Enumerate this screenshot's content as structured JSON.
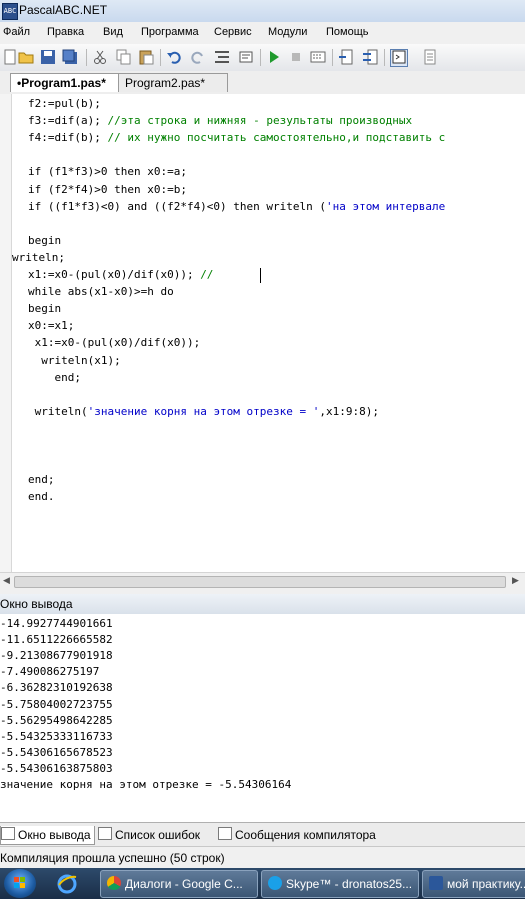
{
  "window": {
    "title": "PascalABC.NET",
    "icon_text": "ABC"
  },
  "menu": [
    "Файл",
    "Правка",
    "Вид",
    "Программа",
    "Сервис",
    "Модули",
    "Помощь"
  ],
  "toolbar": {
    "icons": [
      "new-file-icon",
      "open-folder-icon",
      "save-icon",
      "save-all-icon",
      "cut-icon",
      "copy-icon",
      "paste-icon",
      "undo-icon",
      "redo-icon",
      "format-icon",
      "find-icon",
      "run-icon",
      "stop-icon",
      "compile-icon",
      "debug-step-icon",
      "step-over-icon",
      "output-window-icon",
      "options-icon"
    ]
  },
  "tabs": [
    "•Program1.pas*",
    "Program2.pas*"
  ],
  "code_lines": [
    [
      [
        "f2:=pul(b);",
        ""
      ]
    ],
    [
      [
        "f3:=dif(a); ",
        ""
      ],
      [
        "//эта строка и нижняя - результаты производных",
        "cm"
      ]
    ],
    [
      [
        "f4:=dif(b); ",
        ""
      ],
      [
        "// их нужно посчитать самостоятельно,и подставить с",
        "cm"
      ]
    ],
    [],
    [
      [
        "if (f1*f3)>0 then x0:=a;",
        ""
      ]
    ],
    [
      [
        "if (f2*f4)>0 then x0:=b;",
        ""
      ]
    ],
    [
      [
        "if ((f1*f3)<0) and ((f2*f4)<0) then writeln (",
        ""
      ],
      [
        "'на этом интервале",
        "str"
      ]
    ],
    [],
    [
      [
        "begin",
        ""
      ]
    ],
    [
      [
        "writeln;",
        ""
      ]
    ],
    [
      [
        "x1:=x0-(pul(x0)/dif(x0)); ",
        ""
      ],
      [
        "//",
        "cm"
      ]
    ],
    [
      [
        "while abs(x1-x0)>=h do",
        ""
      ]
    ],
    [
      [
        "begin",
        ""
      ]
    ],
    [
      [
        "x0:=x1;",
        ""
      ]
    ],
    [
      [
        " x1:=x0-(pul(x0)/dif(x0));",
        ""
      ]
    ],
    [
      [
        "  writeln(x1);",
        ""
      ]
    ],
    [
      [
        "    end;",
        ""
      ]
    ],
    [],
    [
      [
        " writeln(",
        ""
      ],
      [
        "'значение корня на этом отрезке = '",
        "str"
      ],
      [
        ",x1:9:8);",
        ""
      ]
    ],
    [],
    [],
    [],
    [
      [
        "end;",
        ""
      ]
    ],
    [
      [
        "end.",
        ""
      ]
    ]
  ],
  "output_panel": {
    "title": "Окно вывода",
    "lines": [
      "-14.9927744901661",
      "-11.6511226665582",
      "-9.21308677901918",
      "-7.490086275197",
      "-6.36282310192638",
      "-5.75804002723755",
      "-5.56295498642285",
      "-5.54325333116733",
      "-5.54306165678523",
      "-5.54306163875803",
      "значение корня на этом отрезке = -5.54306164"
    ]
  },
  "bottom_tabs": [
    "Окно вывода",
    "Список ошибок",
    "Сообщения компилятора"
  ],
  "status": "Компиляция прошла успешно (50 строк)",
  "taskbar": {
    "items": [
      "Диалоги - Google C...",
      "Skype™ - dronatos25...",
      "мой практику..."
    ]
  }
}
